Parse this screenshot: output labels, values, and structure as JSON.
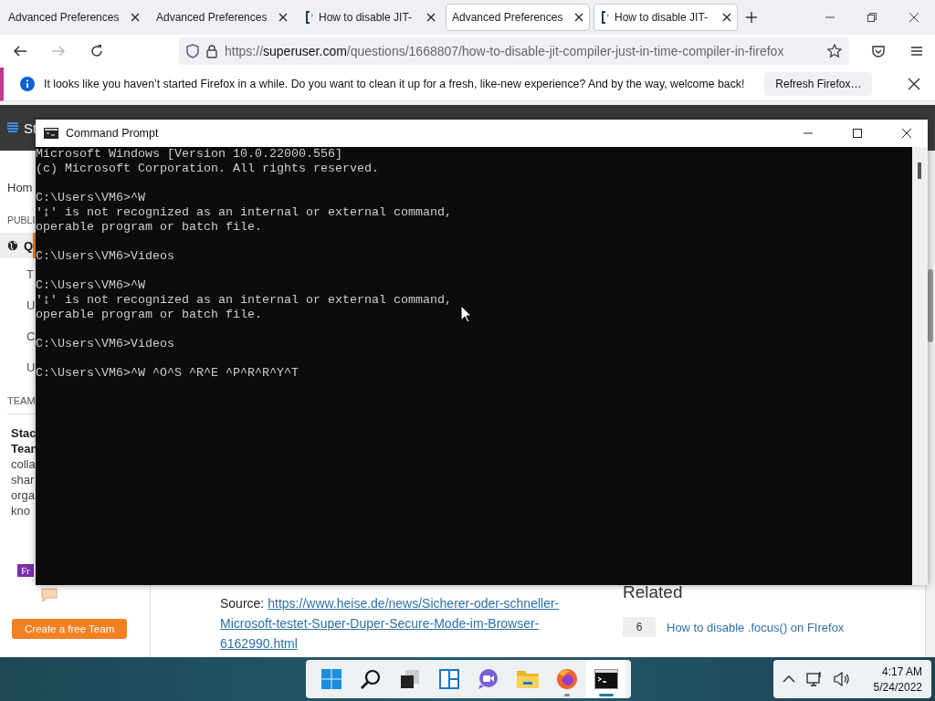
{
  "browser": {
    "tabs": [
      {
        "title": "Advanced Preferences",
        "kind": "prefs",
        "selected": false
      },
      {
        "title": "Advanced Preferences",
        "kind": "prefs",
        "selected": false
      },
      {
        "title": "How to disable JIT-",
        "kind": "site",
        "selected": false
      },
      {
        "title": "Advanced Preferences",
        "kind": "prefs",
        "selected": true
      },
      {
        "title": "How to disable JIT-",
        "kind": "site",
        "selected": true
      }
    ],
    "url": {
      "scheme": "https://",
      "host": "superuser.com",
      "path": "/questions/1668807/how-to-disable-jit-compiler-just-in-time-compiler-in-firefox"
    },
    "notification": {
      "message": "It looks like you haven’t started Firefox in a while. Do you want to clean it up for a fresh, like-new experience? And by the way, welcome back!",
      "button": "Refresh Firefox…"
    }
  },
  "page": {
    "site_name": "St",
    "sidebar": {
      "home": "Hom",
      "section": "PUBLI",
      "items": [
        {
          "label": "Q",
          "selected": true
        },
        {
          "label": "T",
          "selected": false
        },
        {
          "label": "U",
          "selected": false
        },
        {
          "label": "C",
          "selected": false
        },
        {
          "label": "U",
          "selected": false
        }
      ],
      "teams_heading": "TEAM"
    },
    "promo": {
      "title_lines": [
        "Stac",
        "Tean"
      ],
      "text_lines": [
        "colla",
        "shar",
        "orga",
        "kno"
      ],
      "badge": "Fr",
      "button": "Create a free Team"
    },
    "source": {
      "label": "Source:",
      "link": "https://www.heise.de/news/Sicherer-oder-schneller-Microsoft-testet-Super-Duper-Secure-Mode-im-Browser-6162990.html"
    },
    "related": {
      "title": "Related",
      "items": [
        {
          "count": "6",
          "title": "How to disable .focus() on FIrefox"
        }
      ]
    }
  },
  "command_prompt": {
    "title": "Command Prompt",
    "blocks": [
      [
        "Microsoft Windows [Version 10.0.22000.556]",
        "(c) Microsoft Corporation. All rights reserved."
      ],
      [
        "C:\\Users\\VM6>^W",
        "'↨' is not recognized as an internal or external command,",
        "operable program or batch file."
      ],
      [
        "C:\\Users\\VM6>Videos"
      ],
      [
        "C:\\Users\\VM6>^W",
        "'↨' is not recognized as an internal or external command,",
        "operable program or batch file."
      ],
      [
        "C:\\Users\\VM6>Videos"
      ],
      [
        "C:\\Users\\VM6>^W ^O^S ^R^E ^P^R^R^Y^T"
      ]
    ]
  },
  "taskbar": {
    "apps": [
      {
        "kind": "start",
        "running": false,
        "selected": false
      },
      {
        "kind": "search",
        "running": false,
        "selected": false
      },
      {
        "kind": "taskview",
        "running": false,
        "selected": false
      },
      {
        "kind": "widgets",
        "running": false,
        "selected": false
      },
      {
        "kind": "chat",
        "running": false,
        "selected": false
      },
      {
        "kind": "folder",
        "running": false,
        "selected": false
      },
      {
        "kind": "browser",
        "running": true,
        "selected": false
      },
      {
        "kind": "terminal",
        "running": true,
        "selected": true
      }
    ],
    "time": "4:17 AM",
    "date": "5/24/2022"
  }
}
